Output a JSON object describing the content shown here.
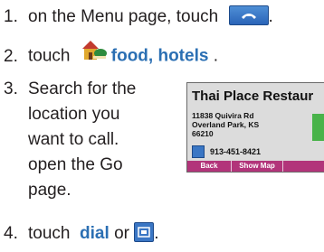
{
  "steps": [
    {
      "num": "1.",
      "text": "on the Menu page, touch"
    },
    {
      "num": "2.",
      "pre": "touch",
      "keyword": "food, hotels",
      "post": "."
    },
    {
      "num": "3.",
      "lines": [
        "Search for the",
        "location you",
        "want to call.",
        "open the Go",
        "page."
      ]
    },
    {
      "num": "4.",
      "pre": "touch",
      "keyword": "dial",
      "mid": "or"
    }
  ],
  "device": {
    "title": "Thai Place Restaur",
    "address": "11838 Quivira Rd\nOverland Park, KS\n66210",
    "phone": "913-451-8421",
    "buttons": [
      "Back",
      "Show Map"
    ]
  },
  "colors": {
    "keyword": "#2b6fb3",
    "button_bar": "#b2347a",
    "green_button": "#49b34a"
  }
}
